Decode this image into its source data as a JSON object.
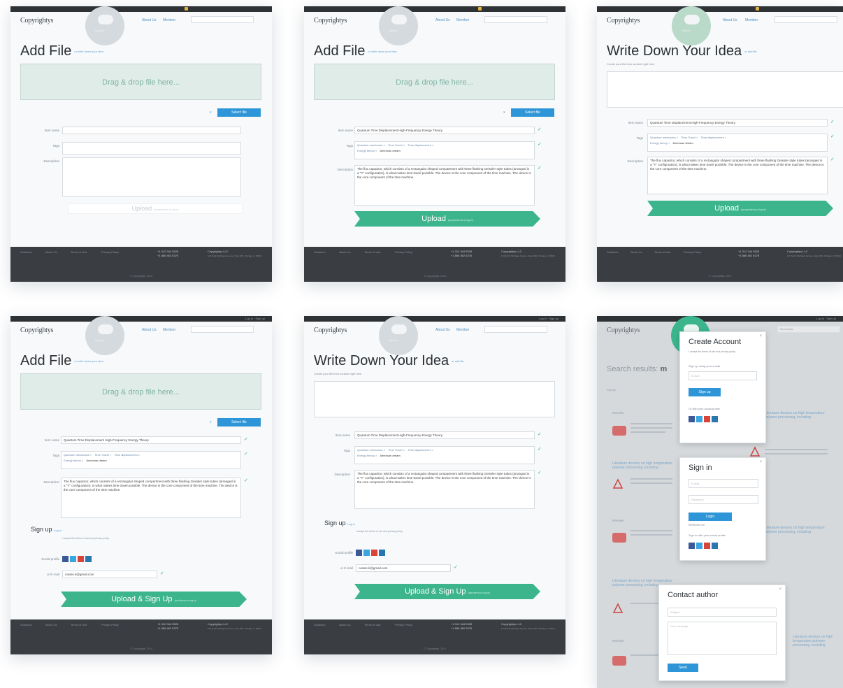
{
  "header": {
    "logo": "Copyrightys",
    "cloud_label": "Upload",
    "nav_about": "About Us",
    "nav_member": "Member",
    "top_auth": "Log in · Sign up"
  },
  "titles": {
    "add_file": "Add File",
    "add_file_sub": "or write down your idea",
    "write_idea": "Write Down Your Idea",
    "write_idea_sub": "or add file",
    "write_idea_hint": "Create your file from scratch right here"
  },
  "dropzone": {
    "label": "Drag & drop file here..."
  },
  "buttons": {
    "select_file": "Select file",
    "upload": "Upload",
    "upload_note": "(accept terms or log in)",
    "upload_signup": "Upload & Sign Up",
    "upload_signup_note": "(and terms or log in)",
    "signup": "Sign up",
    "login": "Login",
    "send": "Send"
  },
  "form": {
    "item_name_label": "Item name",
    "tags_label": "Tags",
    "description_label": "Description",
    "item_name_value": "Quantum Time Displacement High-Frequency Energy Theory",
    "tags": [
      "Quantum mechanics ×",
      "Time Travel ×",
      "Time displacement ×",
      "Energy theory ×"
    ],
    "tag_input": "American dream",
    "description_value": "The flux capacitor, which consists of a rectangular shaped compartment with three flashing Geissler style tubes (arranged in a \"Y\" configuration), is what makes time travel possible. The device is the core component of the time machine. The device is the core component of the time machine.",
    "social_label": "Social profile",
    "email_label": "or E-mail",
    "email_value": "cassie.k@gmail.com"
  },
  "signup": {
    "title": "Sign up",
    "login_link": "Log in",
    "terms": "I accept the terms of use and privacy policy"
  },
  "footer": {
    "links": [
      "Solutions",
      "About Us",
      "Terms of Use",
      "Privacy Policy"
    ],
    "phone1": "+1 312 344 5528",
    "phone2": "+1 866 462 6375",
    "company": "Copyrightys LLC",
    "address": "123 North Michigan Avenue, Suite 900, Chicago, IL 60601",
    "copyright": "© Copyrightys, 2014"
  },
  "results": {
    "title": "Search results:",
    "title_term": "m",
    "search_placeholder": "Find Ideas",
    "sort_label": "Sort by:",
    "item_link": "Literature devices on high temperature polymer processing, including",
    "item_short": "Rennies"
  },
  "modals": {
    "create_title": "Create Account",
    "create_terms": "I accept the terms of use and privacy policy",
    "create_email_hint": "Sign up using your e-mail",
    "email_placeholder": "E-mail",
    "social_hint": "Or with your social profile",
    "signin_title": "Sign in",
    "password_placeholder": "Password",
    "remember": "Remember me",
    "signin_social": "Sign in with your social profile",
    "contact_title": "Contact author",
    "subject_placeholder": "Subject",
    "message_placeholder": "Your message"
  },
  "colors": {
    "accent_blue": "#2e96d8",
    "accent_green": "#3cb58c",
    "footer_dark": "#3a3d41"
  }
}
